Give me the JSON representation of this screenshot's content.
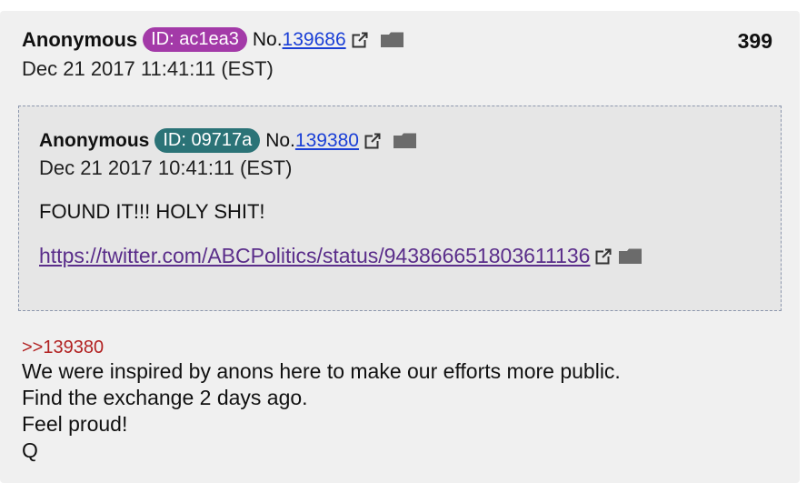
{
  "post": {
    "author": "Anonymous",
    "id_badge": "ID: ac1ea3",
    "id_color": "#a33aa8",
    "no_label": "No.",
    "post_no": "139686",
    "timestamp": "Dec 21 2017 11:41:11 (EST)",
    "post_index": "399",
    "quote_link": ">>139380",
    "body_lines": [
      "We were inspired by anons here to make our efforts more public.",
      "Find the exchange 2 days ago.",
      "Feel proud!",
      "Q"
    ]
  },
  "quoted": {
    "author": "Anonymous",
    "id_badge": "ID: 09717a",
    "id_color": "#2b7377",
    "no_label": "No.",
    "post_no": "139380",
    "timestamp": "Dec 21 2017 10:41:11 (EST)",
    "text": "FOUND IT!!! HOLY SHIT!",
    "url": "https://twitter.com/ABCPolitics/status/943866651803611136"
  },
  "icons": {
    "external": "external-link-icon",
    "folder": "folder-icon"
  }
}
